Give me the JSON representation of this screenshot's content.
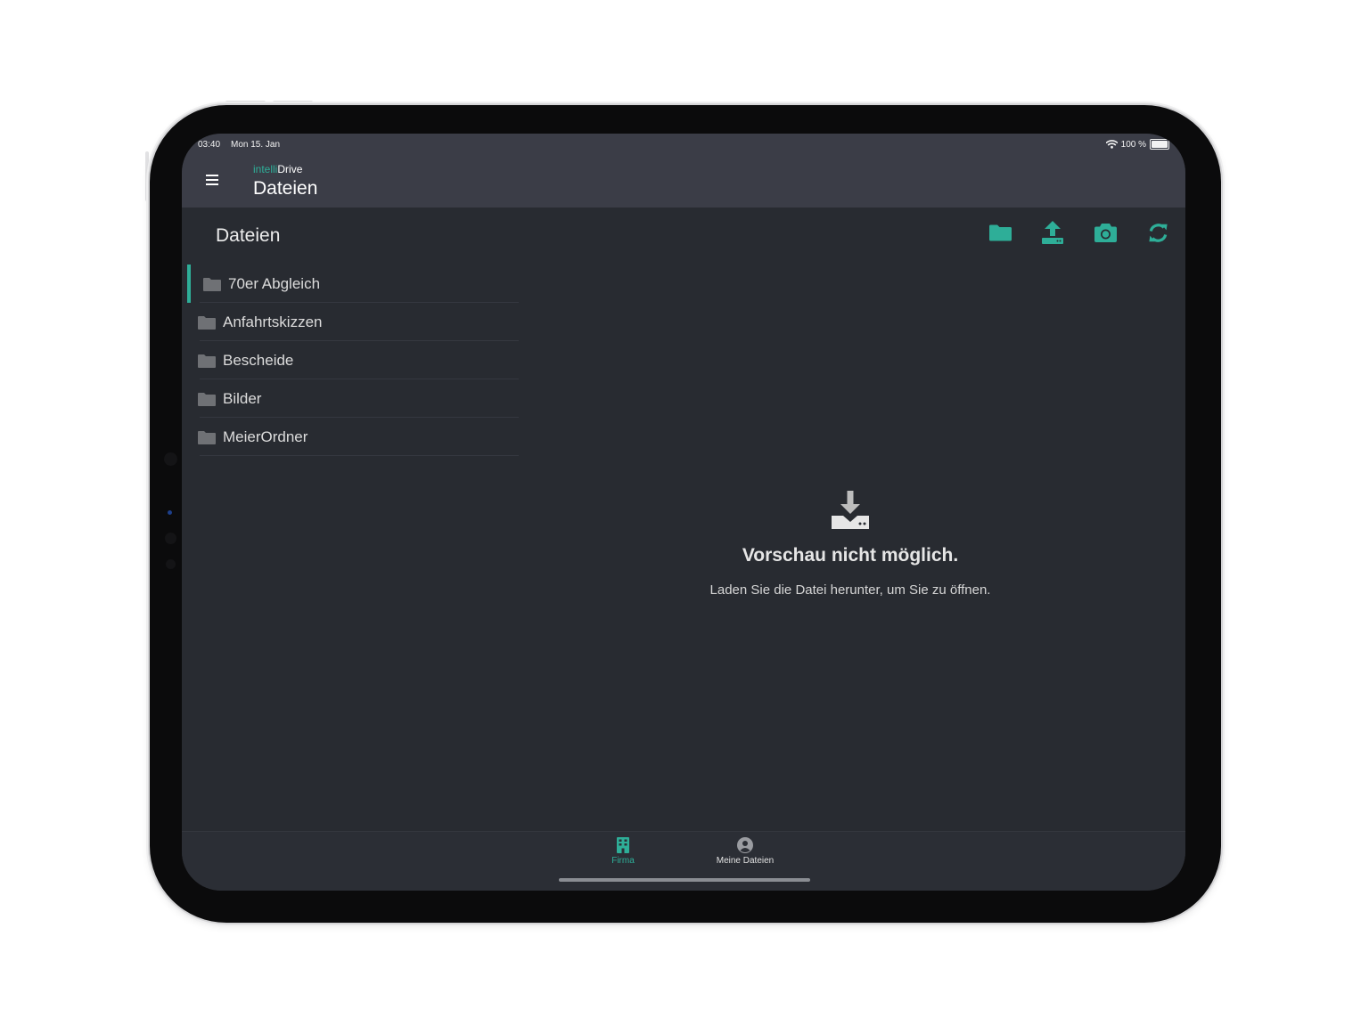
{
  "status_bar": {
    "time": "03:40",
    "date": "Mon 15. Jan",
    "battery": "100 %",
    "battery_level": 1.0
  },
  "header": {
    "brand_prefix": "intelli",
    "brand_suffix": "Drive",
    "title": "Dateien"
  },
  "sidebar": {
    "title": "Dateien",
    "folders": [
      {
        "name": "70er Abgleich",
        "active": true
      },
      {
        "name": "Anfahrtskizzen",
        "active": false
      },
      {
        "name": "Bescheide",
        "active": false
      },
      {
        "name": "Bilder",
        "active": false
      },
      {
        "name": "MeierOrdner",
        "active": false
      }
    ]
  },
  "toolbar": {
    "icons": [
      "folder-icon",
      "upload-icon",
      "camera-icon",
      "refresh-icon"
    ]
  },
  "preview": {
    "title": "Vorschau nicht möglich.",
    "subtitle": "Laden Sie die Datei herunter, um Sie zu öffnen."
  },
  "tabs": [
    {
      "label": "Firma",
      "icon": "building-icon",
      "active": true
    },
    {
      "label": "Meine Dateien",
      "icon": "person-icon",
      "active": false
    }
  ],
  "colors": {
    "accent": "#2eae98",
    "header_bg": "#3b3d47",
    "content_bg": "#282b31",
    "folder_icon": "#6f7175"
  }
}
